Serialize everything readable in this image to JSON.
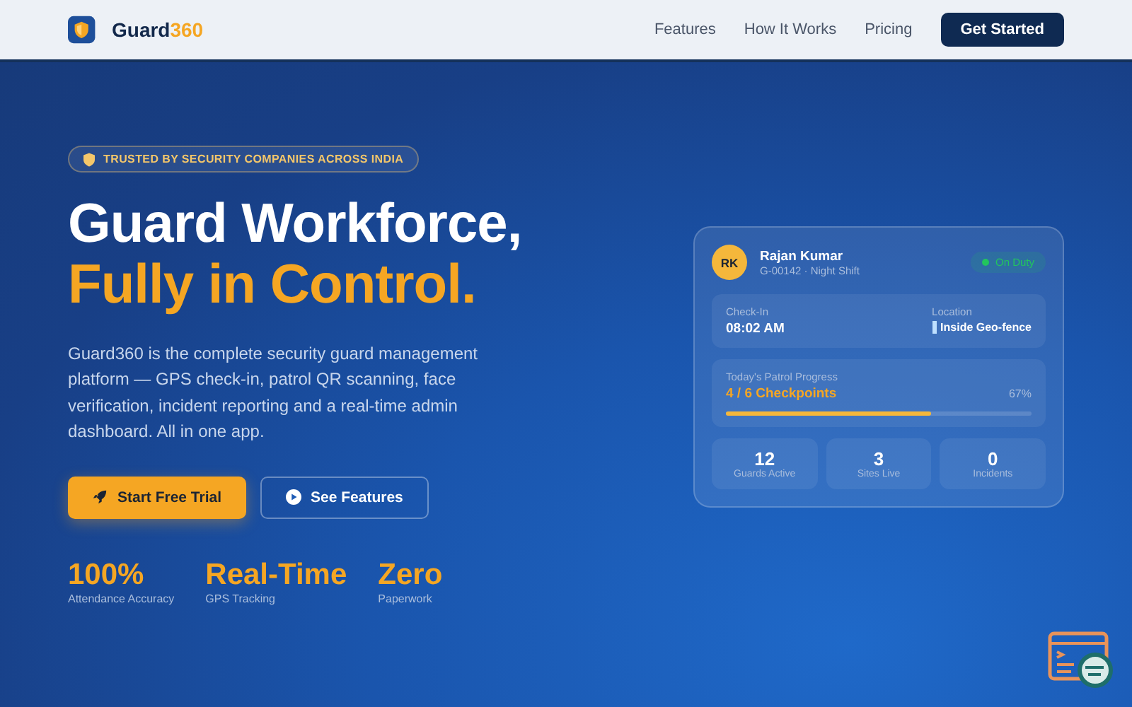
{
  "nav": {
    "brand": "Guard",
    "brand_accent": "360",
    "links": [
      "Features",
      "How It Works",
      "Pricing"
    ],
    "cta": "Get Started"
  },
  "hero": {
    "badge": "TRUSTED BY SECURITY COMPANIES ACROSS INDIA",
    "title_line1": "Guard Workforce,",
    "title_line2": "Fully in Control.",
    "description": "Guard360 is the complete security guard management platform — GPS check-in, patrol QR scanning, face verification, incident reporting and a real-time admin dashboard. All in one app.",
    "primary_button": "Start Free Trial",
    "secondary_button": "See Features",
    "stats": [
      {
        "value": "100%",
        "label": "Attendance Accuracy"
      },
      {
        "value": "Real-Time",
        "label": "GPS Tracking"
      },
      {
        "value": "Zero",
        "label": "Paperwork"
      }
    ]
  },
  "card": {
    "initials": "RK",
    "name": "Rajan Kumar",
    "subtitle": "G-00142 · Night Shift",
    "status": {
      "label": "On Duty",
      "color": "#22c55e"
    },
    "checkin_label": "Check-In",
    "checkin_value": "08:02 AM",
    "location_label": "Location",
    "location_value": "Inside Geo-fence",
    "progress": {
      "label": "Today's Patrol Progress",
      "value": "4 / 6 Checkpoints",
      "percent": "67%",
      "level": 0.67
    },
    "metrics": [
      {
        "value": "12",
        "label": "Guards Active"
      },
      {
        "value": "3",
        "label": "Sites Live"
      },
      {
        "value": "0",
        "label": "Incidents"
      }
    ]
  }
}
